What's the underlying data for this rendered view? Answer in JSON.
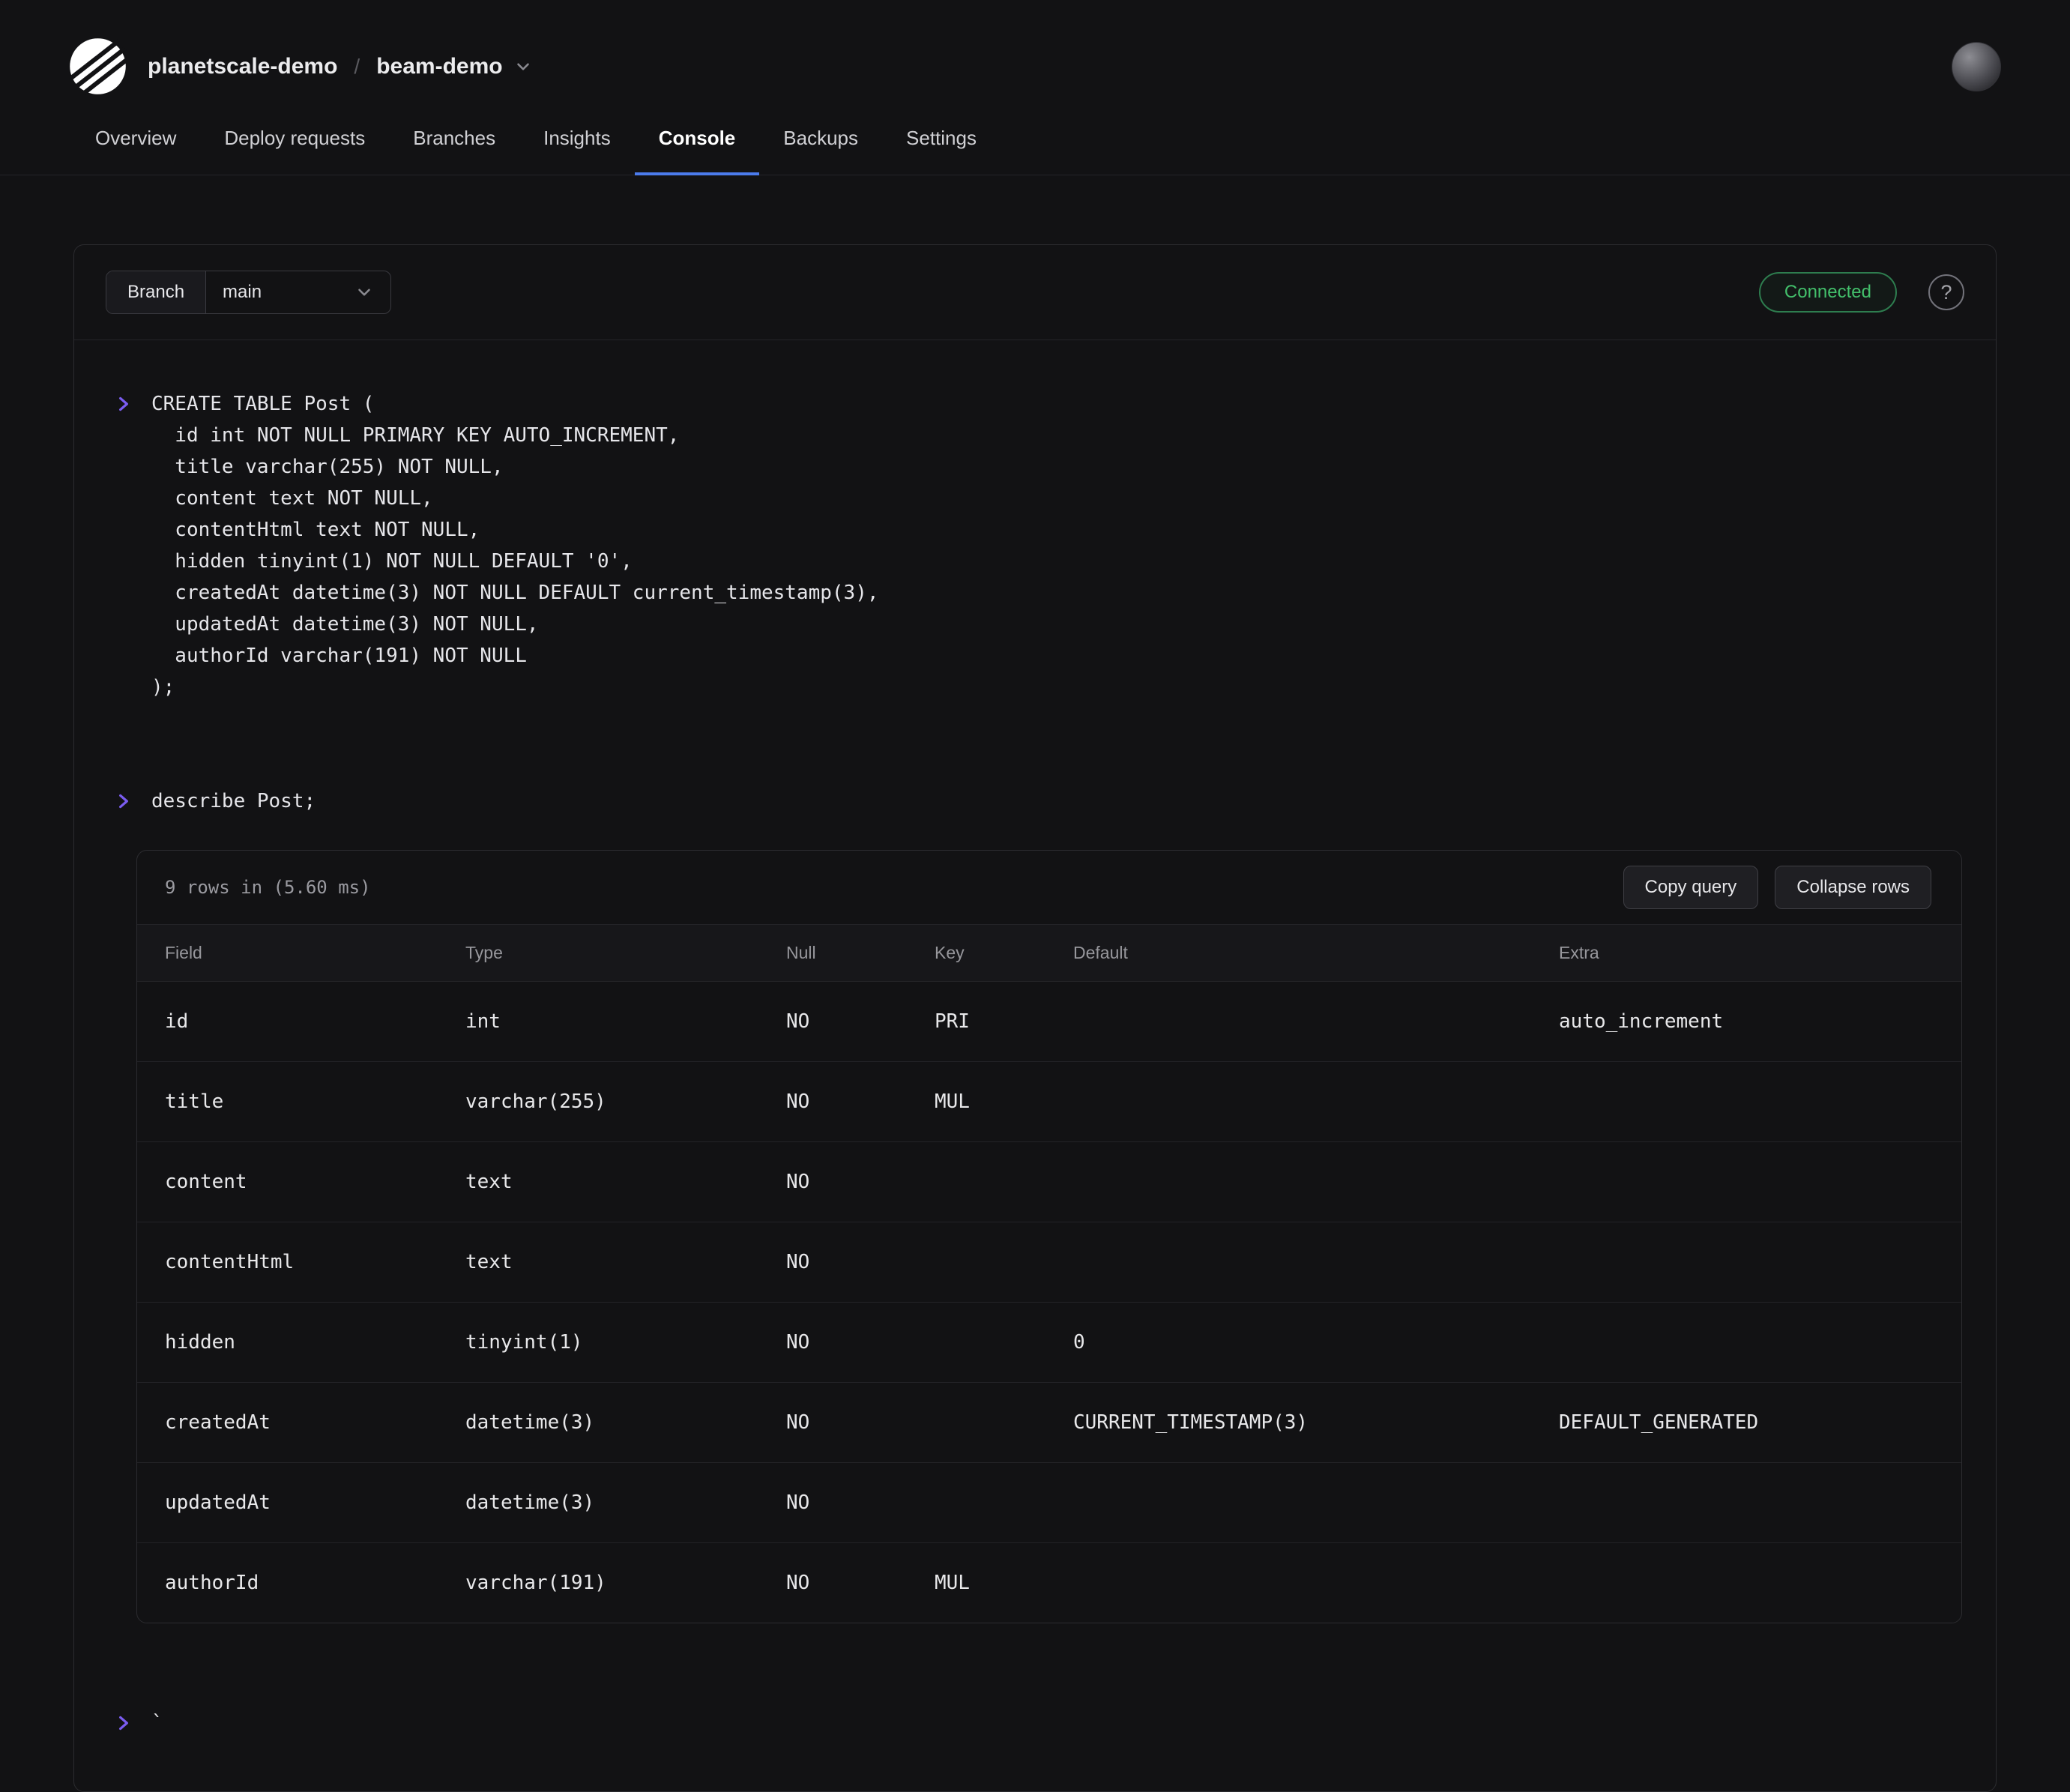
{
  "colors": {
    "accent": "#7a5cf0",
    "status_green": "#43c06b",
    "active_tab_underline": "#4b7bec"
  },
  "header": {
    "org": "planetscale-demo",
    "separator": "/",
    "project": "beam-demo"
  },
  "nav": {
    "tabs": [
      {
        "label": "Overview"
      },
      {
        "label": "Deploy requests"
      },
      {
        "label": "Branches"
      },
      {
        "label": "Insights"
      },
      {
        "label": "Console"
      },
      {
        "label": "Backups"
      },
      {
        "label": "Settings"
      }
    ]
  },
  "console": {
    "branch_label": "Branch",
    "branch_value": "main",
    "status": "Connected",
    "help_glyph": "?",
    "queries": [
      {
        "sql": "CREATE TABLE Post (\n  id int NOT NULL PRIMARY KEY AUTO_INCREMENT,\n  title varchar(255) NOT NULL,\n  content text NOT NULL,\n  contentHtml text NOT NULL,\n  hidden tinyint(1) NOT NULL DEFAULT '0',\n  createdAt datetime(3) NOT NULL DEFAULT current_timestamp(3),\n  updatedAt datetime(3) NOT NULL,\n  authorId varchar(191) NOT NULL\n);"
      },
      {
        "sql": "describe Post;"
      }
    ],
    "result": {
      "summary": "9 rows in (5.60 ms)",
      "copy_button": "Copy query",
      "collapse_button": "Collapse rows",
      "columns": [
        "Field",
        "Type",
        "Null",
        "Key",
        "Default",
        "Extra"
      ],
      "rows": [
        [
          "id",
          "int",
          "NO",
          "PRI",
          "",
          "auto_increment"
        ],
        [
          "title",
          "varchar(255)",
          "NO",
          "MUL",
          "",
          ""
        ],
        [
          "content",
          "text",
          "NO",
          "",
          "",
          ""
        ],
        [
          "contentHtml",
          "text",
          "NO",
          "",
          "",
          ""
        ],
        [
          "hidden",
          "tinyint(1)",
          "NO",
          "",
          "0",
          ""
        ],
        [
          "createdAt",
          "datetime(3)",
          "NO",
          "",
          "CURRENT_TIMESTAMP(3)",
          "DEFAULT_GENERATED"
        ],
        [
          "updatedAt",
          "datetime(3)",
          "NO",
          "",
          "",
          ""
        ],
        [
          "authorId",
          "varchar(191)",
          "NO",
          "MUL",
          "",
          ""
        ]
      ]
    },
    "current_input": "`"
  }
}
